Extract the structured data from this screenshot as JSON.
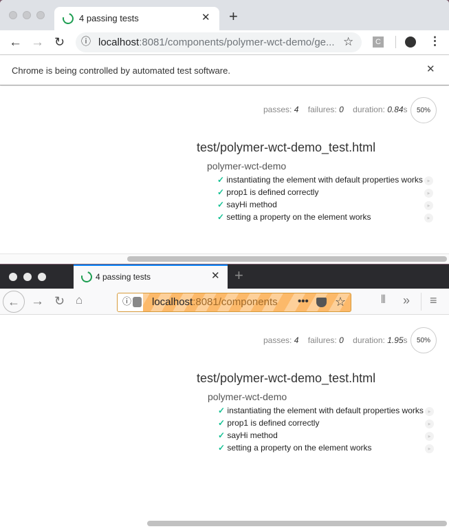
{
  "chrome": {
    "tab_title": "4 passing tests",
    "url_host": "localhost",
    "url_rest": ":8081/components/polymer-wct-demo/ge...",
    "extension_label": "C",
    "infobar_text": "Chrome is being controlled by automated test software.",
    "report": {
      "passes_label": "passes:",
      "passes": "4",
      "failures_label": "failures:",
      "failures": "0",
      "duration_label": "duration:",
      "duration": "0.84",
      "duration_unit": "s",
      "progress": "50%"
    }
  },
  "firefox": {
    "tab_title": "4 passing tests",
    "url_host": "localhost",
    "url_rest": ":8081/components",
    "report": {
      "passes_label": "passes:",
      "passes": "4",
      "failures_label": "failures:",
      "failures": "0",
      "duration_label": "duration:",
      "duration": "1.95",
      "duration_unit": "s",
      "progress": "50%"
    }
  },
  "suite": {
    "file": "test/polymer-wct-demo_test.html",
    "name": "polymer-wct-demo",
    "tests": [
      "instantiating the element with default properties works",
      "prop1 is defined correctly",
      "sayHi method",
      "setting a property on the element works"
    ]
  },
  "colors": {
    "pass": "#13c193",
    "spinner": "#1e9e52",
    "firefox_tab_accent": "#0a84ff"
  }
}
